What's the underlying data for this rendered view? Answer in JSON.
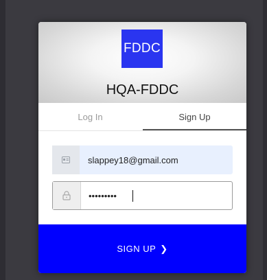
{
  "app": {
    "logo_text": "FDDC",
    "title": "HQA-FDDC"
  },
  "tabs": [
    {
      "label": "Log In",
      "active": false
    },
    {
      "label": "Sign Up",
      "active": true
    }
  ],
  "form": {
    "email": {
      "icon": "id-card-icon",
      "value": "slappey18@gmail.com"
    },
    "password": {
      "icon": "lock-icon",
      "value": "•••••••••"
    }
  },
  "submit": {
    "label": "SIGN UP",
    "chevron": "❯"
  },
  "colors": {
    "accent": "#0000ff",
    "logo_bg": "#2a35f0",
    "autofill_bg": "#e8f0fe",
    "backdrop": "#3b3a40"
  }
}
